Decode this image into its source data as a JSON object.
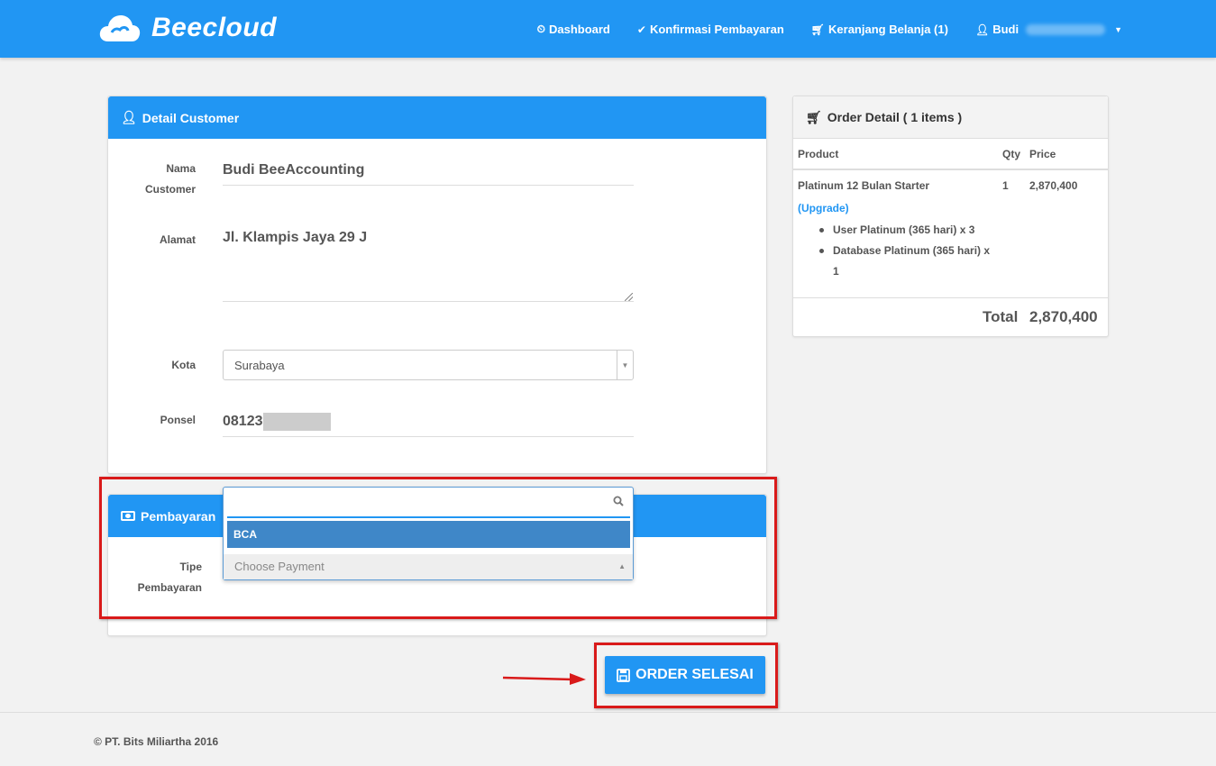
{
  "header": {
    "brand": "Beecloud",
    "nav": [
      {
        "icon": "dashboard-icon",
        "label": "Dashboard"
      },
      {
        "icon": "check-icon",
        "label": "Konfirmasi Pembayaran"
      },
      {
        "icon": "cart-icon",
        "label": "Keranjang Belanja (1)"
      }
    ],
    "user_label": "Budi"
  },
  "customer": {
    "panel_title": "Detail Customer",
    "name_label_line1": "Nama",
    "name_label_line2": "Customer",
    "name_value": "Budi BeeAccounting",
    "address_label": "Alamat",
    "address_value": "Jl. Klampis Jaya 29 J",
    "city_label": "Kota",
    "city_value": "Surabaya",
    "phone_label": "Ponsel",
    "phone_value": "08123"
  },
  "payment": {
    "panel_title": "Pembayaran",
    "type_label_line1": "Tipe",
    "type_label_line2": "Pembayaran",
    "search_value": "",
    "options": [
      "BCA"
    ],
    "placeholder": "Choose Payment"
  },
  "order": {
    "title": "Order Detail ( 1 items )",
    "col_product": "Product",
    "col_qty": "Qty",
    "col_price": "Price",
    "item_name": "Platinum 12 Bulan Starter",
    "item_upgrade": "(Upgrade)",
    "item_qty": "1",
    "item_price": "2,870,400",
    "features": [
      "User Platinum (365 hari) x 3",
      "Database Platinum (365 hari) x 1"
    ],
    "total_label": "Total",
    "total_value": "2,870,400"
  },
  "button": {
    "order_label": "ORDER SELESAI"
  },
  "footer": {
    "copyright": "© PT. Bits Miliartha 2016"
  },
  "colors": {
    "primary": "#2196f3",
    "highlight": "#d91a1a",
    "option_selected": "#3f87c8"
  }
}
